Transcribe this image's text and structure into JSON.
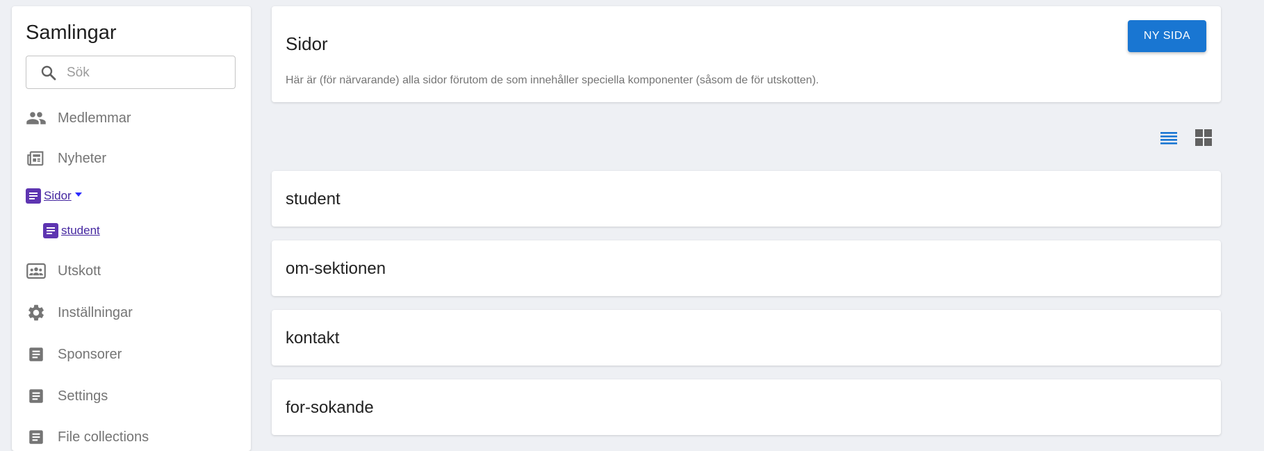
{
  "sidebar": {
    "title": "Samlingar",
    "search": {
      "placeholder": "Sök",
      "value": ""
    },
    "items": [
      {
        "label": "Medlemmar",
        "icon": "people-icon"
      },
      {
        "label": "Nyheter",
        "icon": "newspaper-icon"
      },
      {
        "label": "Sidor",
        "icon": "page-icon",
        "expanded": true,
        "children": [
          {
            "label": "student"
          }
        ]
      },
      {
        "label": "Utskott",
        "icon": "group-card-icon"
      },
      {
        "label": "Inställningar",
        "icon": "gear-icon"
      },
      {
        "label": "Sponsorer",
        "icon": "document-icon"
      },
      {
        "label": "Settings",
        "icon": "document-icon"
      },
      {
        "label": "File collections",
        "icon": "document-icon"
      }
    ]
  },
  "header": {
    "title": "Sidor",
    "description": "Här är (för närvarande) alla sidor förutom de som innehåller speciella komponenter (såsom de för utskotten).",
    "new_button": "NY SIDA"
  },
  "view_toggle": {
    "active": "list"
  },
  "pages": [
    {
      "label": "student"
    },
    {
      "label": "om-sektionen"
    },
    {
      "label": "kontakt"
    },
    {
      "label": "for-sokande"
    }
  ],
  "colors": {
    "accent": "#1976d2",
    "purple": "#5e35b1",
    "link": "#4527a0",
    "icon_gray": "#757575"
  }
}
